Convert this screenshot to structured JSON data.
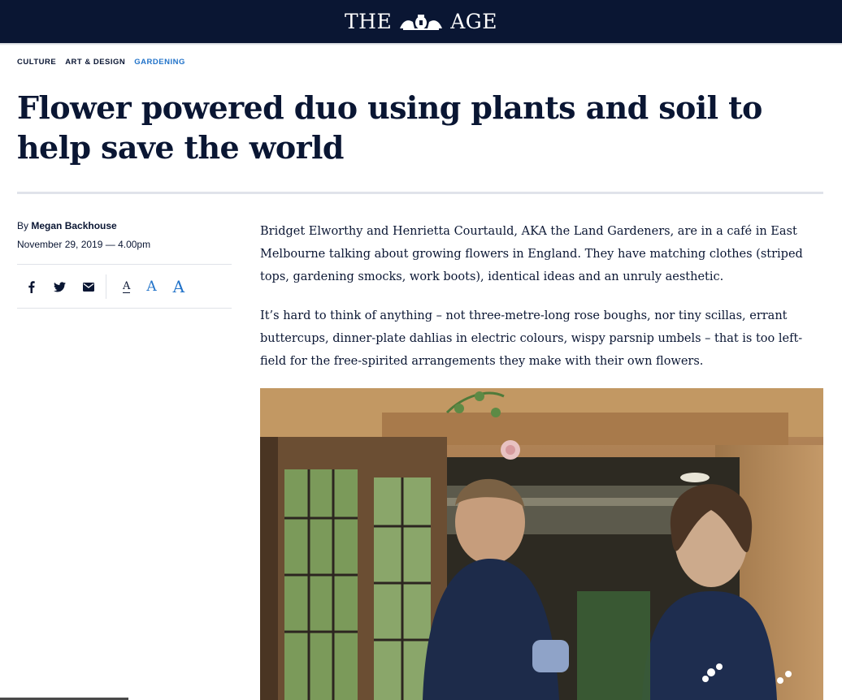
{
  "masthead": {
    "word_left": "THE",
    "word_right": "AGE",
    "crest_icon": "royal-crest-icon",
    "background": "#0a1633"
  },
  "breadcrumbs": [
    {
      "label": "CULTURE",
      "active": false
    },
    {
      "label": "ART & DESIGN",
      "active": false
    },
    {
      "label": "GARDENING",
      "active": true
    }
  ],
  "article": {
    "headline": "Flower powered duo using plants and soil to help save the world",
    "byline_prefix": "By",
    "author": "Megan Backhouse",
    "date": "November 29, 2019 — 4.00pm",
    "paragraphs": [
      "Bridget Elworthy and Henrietta Courtauld, AKA the Land Gardeners, are in a café in East Melbourne talking about growing flowers in England. They have matching clothes (striped tops, gardening smocks, work boots), identical ideas and an unruly aesthetic.",
      "It’s hard to think of anything – not three-metre-long rose boughs, nor tiny scillas, errant buttercups, dinner-plate dahlias in electric colours, wispy parsnip umbels – that is too left-field for the free-spirited arrangements they make with their own flowers."
    ]
  },
  "share": {
    "facebook_icon": "facebook-icon",
    "twitter_icon": "twitter-icon",
    "email_icon": "email-icon"
  },
  "font_size": {
    "small": "A",
    "medium": "A",
    "large": "A"
  },
  "colors": {
    "navy": "#0a1633",
    "accent_blue": "#2273c9",
    "rule": "#e0e3ea"
  }
}
